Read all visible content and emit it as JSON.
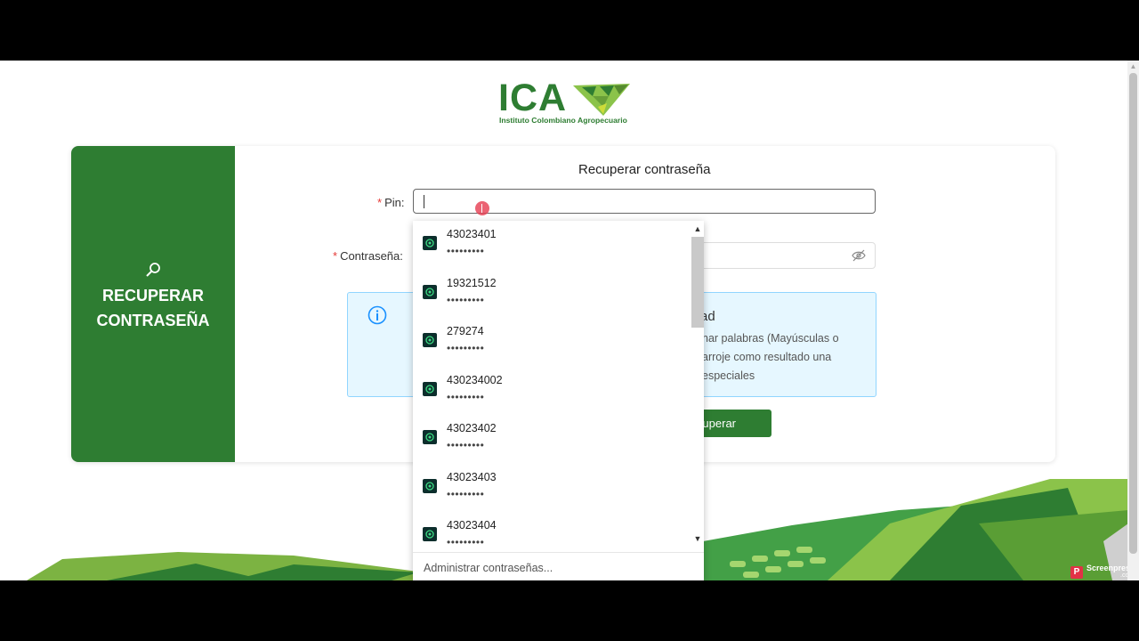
{
  "logo": {
    "word": "ICA",
    "subtitle": "Instituto Colombiano Agropecuario"
  },
  "side_panel": {
    "title_line1": "RECUPERAR",
    "title_line2": "CONTRASEÑA"
  },
  "form": {
    "title": "Recuperar contraseña",
    "pin_label": "Pin",
    "password_label": "Contraseña",
    "required_mark": "*",
    "colon": ":",
    "pin_value": "",
    "password_value": ""
  },
  "info": {
    "heading_partial": "ad",
    "line1_partial": "nar palabras (Mayúsculas o",
    "line2_partial": "arroje como resultado una",
    "line3_partial": "especiales"
  },
  "button": {
    "label_partial": "uperar"
  },
  "autofill": {
    "items": [
      {
        "user": "43023401",
        "masked": "•••••••••"
      },
      {
        "user": "19321512",
        "masked": "•••••••••"
      },
      {
        "user": "279274",
        "masked": "•••••••••"
      },
      {
        "user": "430234002",
        "masked": "•••••••••"
      },
      {
        "user": "43023402",
        "masked": "•••••••••"
      },
      {
        "user": "43023403",
        "masked": "•••••••••"
      },
      {
        "user": "43023404",
        "masked": "•••••••••"
      }
    ],
    "footer": "Administrar contraseñas..."
  },
  "watermark": {
    "brand": "Screenpresso",
    "suffix": ".com"
  },
  "colors": {
    "brand_green": "#2e7d32",
    "info_bg": "#e6f7ff",
    "info_border": "#91d5ff",
    "required": "#e53935"
  },
  "icons": {
    "side": "search-key-icon",
    "info": "info-circle-icon",
    "eye": "eye-invisible-icon",
    "autofill": "key-badge-icon"
  }
}
